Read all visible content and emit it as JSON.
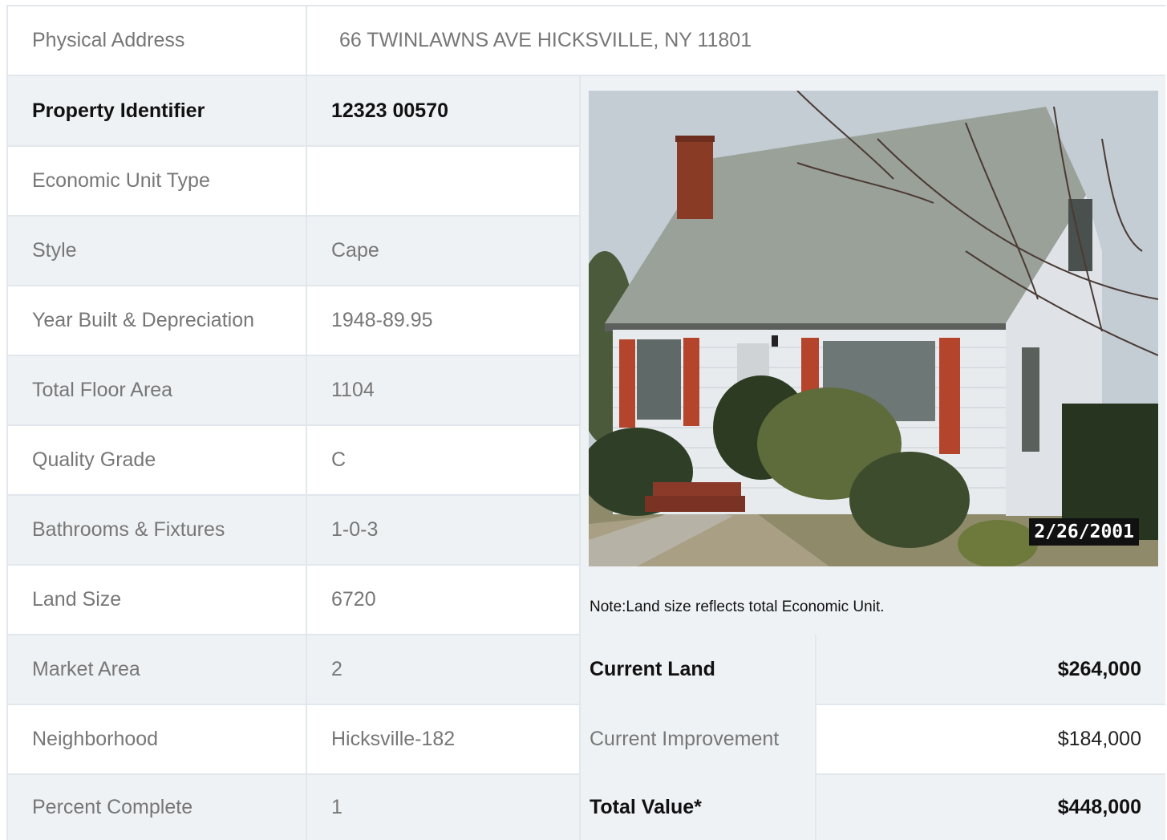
{
  "address": {
    "label": "Physical Address",
    "value": "66  TWINLAWNS AVE  HICKSVILLE, NY  11801"
  },
  "rows": [
    {
      "label": "Property Identifier",
      "value": "12323  00570"
    },
    {
      "label": "Economic Unit Type",
      "value": ""
    },
    {
      "label": "Style",
      "value": "Cape"
    },
    {
      "label": "Year Built & Depreciation",
      "value": "1948-89.95"
    },
    {
      "label": "Total Floor Area",
      "value": "1104"
    },
    {
      "label": "Quality Grade",
      "value": "C"
    },
    {
      "label": "Bathrooms & Fixtures",
      "value": "1-0-3"
    },
    {
      "label": "Land Size",
      "value": "6720"
    },
    {
      "label": "Market Area",
      "value": "2"
    },
    {
      "label": "Neighborhood",
      "value": "Hicksville-182"
    },
    {
      "label": "Percent Complete",
      "value": "1"
    }
  ],
  "photo": {
    "date_stamp": "2/26/2001"
  },
  "note": "Note:Land size reflects total Economic Unit.",
  "valuation": [
    {
      "label": "Current Land",
      "value": "$264,000"
    },
    {
      "label": "Current Improvement",
      "value": "$184,000"
    },
    {
      "label": "Total Value*",
      "value": "$448,000"
    }
  ],
  "colors": {
    "shade": "#eff2f5",
    "border": "#e2e7ec",
    "text": "#777777",
    "bold_text": "#111111"
  }
}
